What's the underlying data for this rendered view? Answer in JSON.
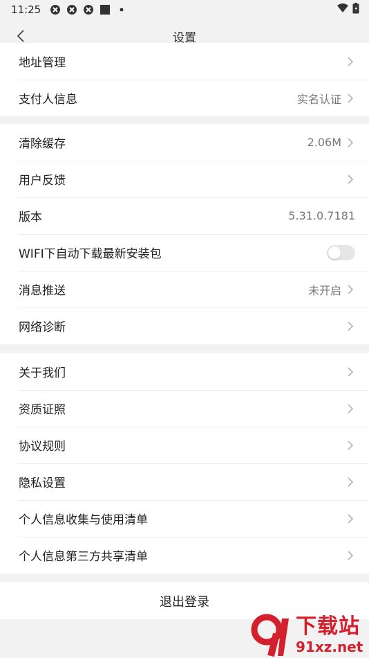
{
  "status_bar": {
    "time": "11:25",
    "icons": [
      "app-icon",
      "app-icon",
      "app-icon",
      "square-icon",
      "dot-icon"
    ],
    "right_icons": [
      "wifi-icon",
      "battery-icon"
    ]
  },
  "header": {
    "title": "设置",
    "back_icon": "chevron-left-icon"
  },
  "groups": [
    {
      "rows": [
        {
          "label": "地址管理",
          "value": "",
          "chevron": true
        },
        {
          "label": "支付人信息",
          "value": "实名认证",
          "chevron": true
        }
      ]
    },
    {
      "rows": [
        {
          "label": "清除缓存",
          "value": "2.06M",
          "chevron": true
        },
        {
          "label": "用户反馈",
          "value": "",
          "chevron": true
        },
        {
          "label": "版本",
          "value": "5.31.0.7181",
          "chevron": false
        },
        {
          "label": "WIFI下自动下载最新安装包",
          "toggle": false
        },
        {
          "label": "消息推送",
          "value": "未开启",
          "chevron": true
        },
        {
          "label": "网络诊断",
          "value": "",
          "chevron": true
        }
      ]
    },
    {
      "rows": [
        {
          "label": "关于我们",
          "value": "",
          "chevron": true
        },
        {
          "label": "资质证照",
          "value": "",
          "chevron": true
        },
        {
          "label": "协议规则",
          "value": "",
          "chevron": true
        },
        {
          "label": "隐私设置",
          "value": "",
          "chevron": true
        },
        {
          "label": "个人信息收集与使用清单",
          "value": "",
          "chevron": true
        },
        {
          "label": "个人信息第三方共享清单",
          "value": "",
          "chevron": true
        }
      ]
    }
  ],
  "logout_label": "退出登录",
  "watermark": {
    "big": "下载站",
    "small": "91xz.net",
    "color": "#d4202c"
  }
}
